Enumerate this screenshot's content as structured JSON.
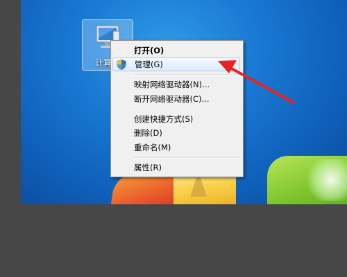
{
  "desktop": {
    "icon_label": "计算"
  },
  "context_menu": {
    "items": [
      {
        "label": "打开(O)",
        "bold": true
      },
      {
        "label": "管理(G)",
        "highlighted": true,
        "icon": "uac-shield-icon"
      },
      {
        "label": "映射网络驱动器(N)..."
      },
      {
        "label": "断开网络驱动器(C)..."
      },
      {
        "label": "创建快捷方式(S)"
      },
      {
        "label": "删除(D)"
      },
      {
        "label": "重命名(M)"
      },
      {
        "label": "属性(R)"
      }
    ]
  },
  "annotation": {
    "arrow_color": "#e8231f"
  }
}
